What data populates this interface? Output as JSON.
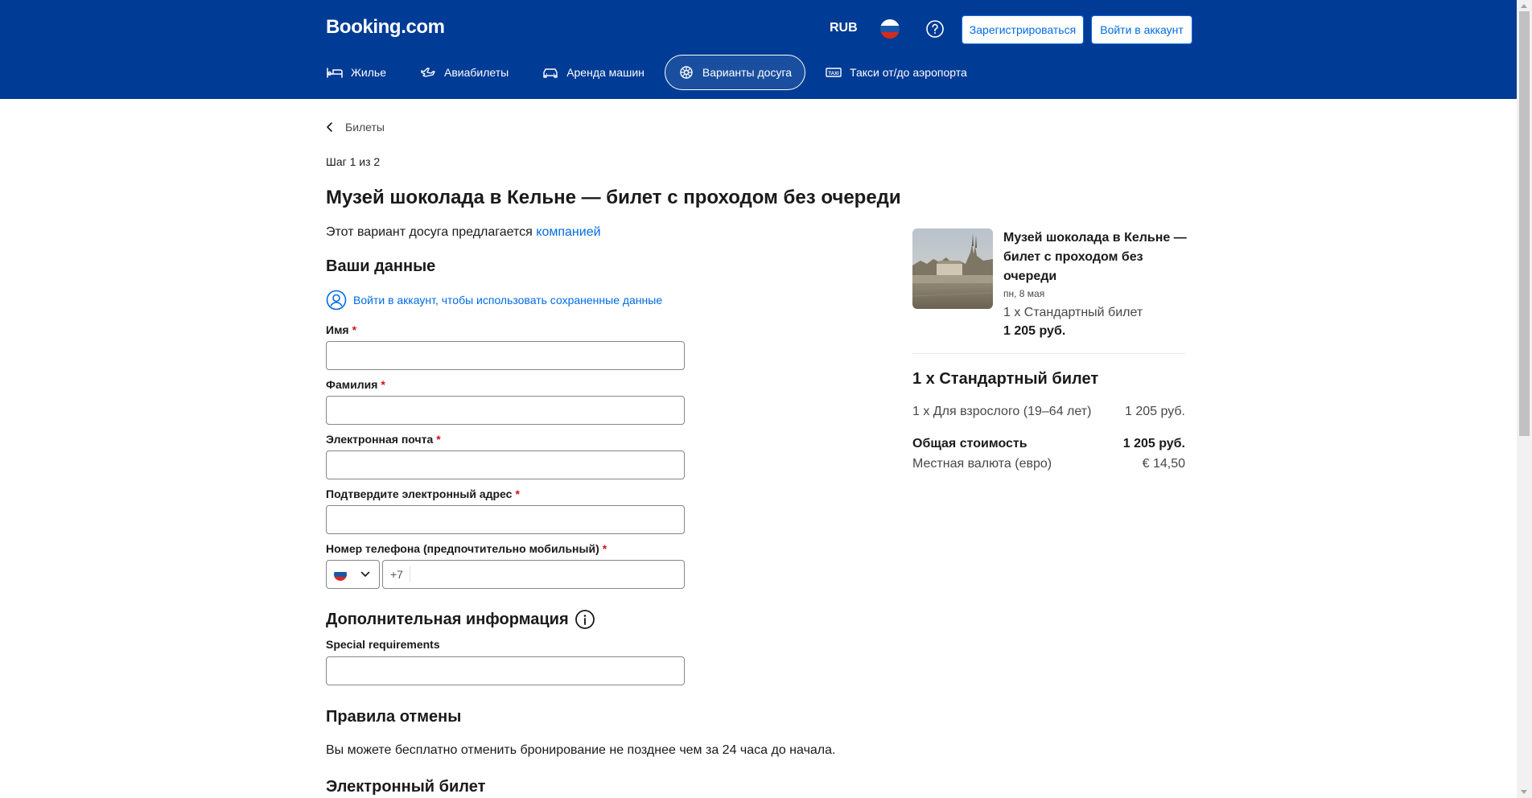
{
  "header": {
    "logo": "Booking.com",
    "currency": "RUB",
    "register_label": "Зарегистрироваться",
    "login_label": "Войти в аккаунт",
    "nav": [
      {
        "label": "Жилье",
        "icon": "bed-icon",
        "active": false
      },
      {
        "label": "Авиабилеты",
        "icon": "plane-icon",
        "active": false
      },
      {
        "label": "Аренда машин",
        "icon": "car-icon",
        "active": false
      },
      {
        "label": "Варианты досуга",
        "icon": "attractions-icon",
        "active": true
      },
      {
        "label": "Такси от/до аэропорта",
        "icon": "taxi-icon",
        "active": false
      }
    ]
  },
  "breadcrumb": "Билеты",
  "step": "Шаг 1 из 2",
  "title": "Музей шоколада в Кельне — билет с проходом без очереди",
  "offered": {
    "prefix": "Этот вариант досуга предлагается ",
    "link": "компанией"
  },
  "your_data": {
    "heading": "Ваши данные",
    "signin_link": "Войти в аккаунт, чтобы использовать сохраненные данные",
    "fields": {
      "first_name": "Имя",
      "last_name": "Фамилия",
      "email": "Электронная почта",
      "confirm_email": "Подтвердите электронный адрес",
      "phone": "Номер телефона (предпочтительно мобильный)"
    },
    "required_mark": "*",
    "phone_code": "+7"
  },
  "additional": {
    "heading": "Дополнительная информация",
    "special_label": "Special requirements"
  },
  "cancellation": {
    "heading": "Правила отмены",
    "text": "Вы можете бесплатно отменить бронирование не позднее чем за 24 часа до начала."
  },
  "eticket": {
    "heading": "Электронный билет"
  },
  "sidebar": {
    "title": "Музей шоколада в Кельне — билет с проходом без очереди",
    "date": "пн, 8 мая",
    "ticket": "1 x Стандартный билет",
    "price": "1 205 руб.",
    "summary_title": "1 x Стандартный билет",
    "adult_label": "1 x Для взрослого (19–64 лет)",
    "adult_price": "1 205 руб.",
    "total_label": "Общая стоимость",
    "total_price": "1 205 руб.",
    "local_label": "Местная валюта (евро)",
    "local_price": "€ 14,50"
  },
  "colors": {
    "brand": "#003b95",
    "link": "#006ce4",
    "required": "#d4111e"
  }
}
